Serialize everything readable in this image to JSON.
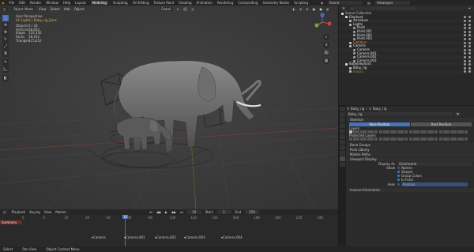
{
  "menubar": {
    "menus": [
      "File",
      "Edit",
      "Render",
      "Window",
      "Help"
    ],
    "workspaces": [
      "Layout",
      "Modeling",
      "Sculpting",
      "UV Editing",
      "Texture Paint",
      "Shading",
      "Animation",
      "Rendering",
      "Compositing",
      "Geometry Nodes",
      "Scripting"
    ],
    "active_workspace": "Modeling",
    "scene": "Scene",
    "view_layer": "ViewLayer"
  },
  "viewport": {
    "mode": "Object Mode",
    "menus": [
      "View",
      "Select",
      "Add",
      "Object"
    ],
    "orientation": "Global",
    "perspective": "User Perspective",
    "collection": "(0) Lights | Baby_rig_Eyes",
    "stats": [
      {
        "label": "Objects",
        "value": "0 / 18"
      },
      {
        "label": "Vertices",
        "value": "58,002"
      },
      {
        "label": "Edges",
        "value": "116,156"
      },
      {
        "label": "Faces",
        "value": "58,102"
      },
      {
        "label": "Triangles",
        "value": "115,652"
      }
    ],
    "gizmo_axes": {
      "x": "X",
      "y": "Y",
      "z": "Z"
    },
    "colors": {
      "viewport_bg": "#3a3a3a",
      "x_axis": "#d84b4b",
      "y_axis": "#7fb34b",
      "z_axis": "#4b7fd8"
    }
  },
  "timeline": {
    "menus": [
      "Playback",
      "Keying",
      "View",
      "Marker"
    ],
    "current_frame": "10",
    "start": "Start",
    "start_value": "1",
    "end": "End",
    "end_value": "250",
    "ruler_ticks": [
      "0",
      "5",
      "10",
      "20",
      "40",
      "60",
      "80",
      "100",
      "120",
      "140",
      "160",
      "180",
      "200",
      "220",
      "240"
    ],
    "summary_label": "Summary",
    "markers": [
      "Camera",
      "Camera.001",
      "Camera.002",
      "Camera.003",
      "Camera.004"
    ],
    "status": [
      "Select",
      "Pan View",
      "Object Context Menu"
    ]
  },
  "outliner": {
    "title": "Scene Collection",
    "items": [
      {
        "label": "Elephant",
        "depth": 1,
        "color": "#e0e0e0"
      },
      {
        "label": "Armature",
        "depth": 2,
        "color": "#e0e0e0"
      },
      {
        "label": "Lights",
        "depth": 2,
        "color": "#e0e0e0"
      },
      {
        "label": "Point",
        "depth": 3,
        "color": "#e0e0e0"
      },
      {
        "label": "Point.001",
        "depth": 3,
        "color": "#e0e0e0"
      },
      {
        "label": "Point.002",
        "depth": 3,
        "color": "#e0e0e0"
      },
      {
        "label": "Point.003",
        "depth": 3,
        "color": "#e0e0e0"
      },
      {
        "label": "Colliders",
        "depth": 2,
        "color": "#e08a4b"
      },
      {
        "label": "Camera",
        "depth": 2,
        "color": "#e0e0e0"
      },
      {
        "label": "Camera",
        "depth": 3,
        "color": "#e0e0e0"
      },
      {
        "label": "Camera.001",
        "depth": 3,
        "color": "#e0e0e0"
      },
      {
        "label": "Camera.002",
        "depth": 3,
        "color": "#e0e0e0"
      },
      {
        "label": "Camera.003",
        "depth": 3,
        "color": "#e0e0e0"
      },
      {
        "label": "BabyElephant",
        "depth": 1,
        "color": "#e0e0e0"
      },
      {
        "label": "Baby_rig",
        "depth": 2,
        "color": "#e0e0e0"
      },
      {
        "label": "Empty",
        "depth": 2,
        "color": "#9a7f58"
      }
    ]
  },
  "properties": {
    "object_name": "Baby_rig",
    "data_name": "Baby_rig",
    "sections": {
      "skeleton": "Skeleton",
      "pose_position": "Pose Position",
      "rest_position": "Rest Position",
      "layers": "Layers",
      "protected_layers": "Protected Layers",
      "bone_groups": "Bone Groups",
      "pose_library": "Pose Library",
      "motion_paths": "Motion Paths",
      "viewport_display": "Viewport Display",
      "inverse_kinematics": "Inverse Kinematics"
    },
    "display_as_label": "Display As",
    "display_as_value": "Octahedral",
    "show_label": "Show",
    "show_options": [
      {
        "label": "Names",
        "checked": false
      },
      {
        "label": "Shapes",
        "checked": true
      },
      {
        "label": "Group Colors",
        "checked": true
      },
      {
        "label": "In Front",
        "checked": true
      }
    ],
    "axes_label": "Axes",
    "axes_value": "Position",
    "accent_color": "#4772b3"
  }
}
